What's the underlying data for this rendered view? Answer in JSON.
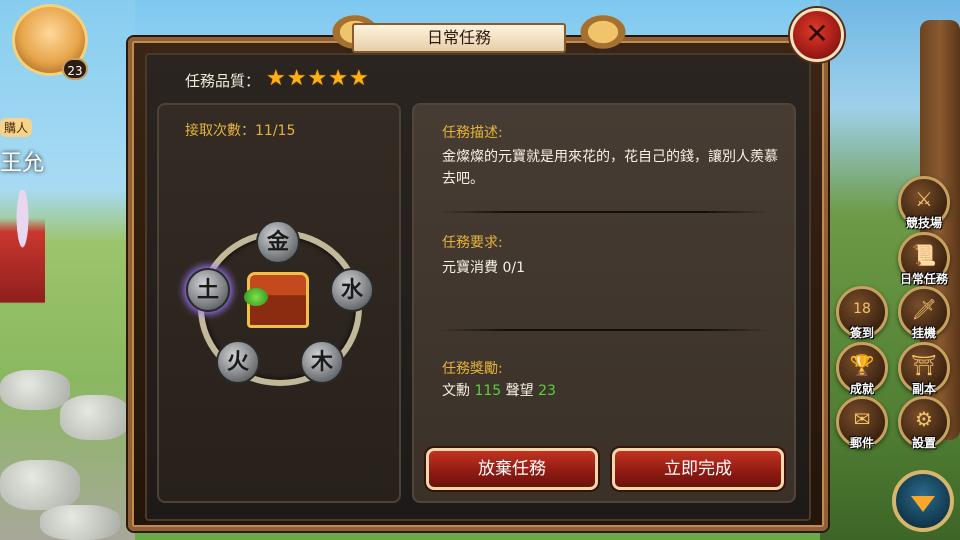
{
  "player": {
    "level": "23"
  },
  "npc": {
    "title": "購人",
    "name": "王允"
  },
  "dialog": {
    "title": "日常任務",
    "close_icon": "✕",
    "quality_label": "任務品質：",
    "stars": 5,
    "accept_count": "接取次數：11/15",
    "elements": [
      "金",
      "水",
      "木",
      "火",
      "土"
    ],
    "description_label": "任務描述:",
    "description_text": "金燦燦的元寶就是用來花的，花自己的錢，讓別人羨慕去吧。",
    "requirement_label": "任務要求:",
    "requirement_text": "元寶消費 0/1",
    "reward_label": "任務獎勵:",
    "reward_item1_name": "文勳",
    "reward_item1_value": "115",
    "reward_item2_name": "聲望",
    "reward_item2_value": "23",
    "abandon_button": "放棄任務",
    "complete_button": "立即完成"
  },
  "side_menu": {
    "arena": "競技場",
    "daily_task": "日常任務",
    "sign_in": "簽到",
    "idle": "挂機",
    "achievement": "成就",
    "dungeon": "副本",
    "mail": "郵件",
    "settings": "設置",
    "calendar_day": "18"
  },
  "colors": {
    "accent_gold": "#e6b23a",
    "reward_green": "#58d13a",
    "star": "#ffb014",
    "button_red": "#c23323"
  }
}
